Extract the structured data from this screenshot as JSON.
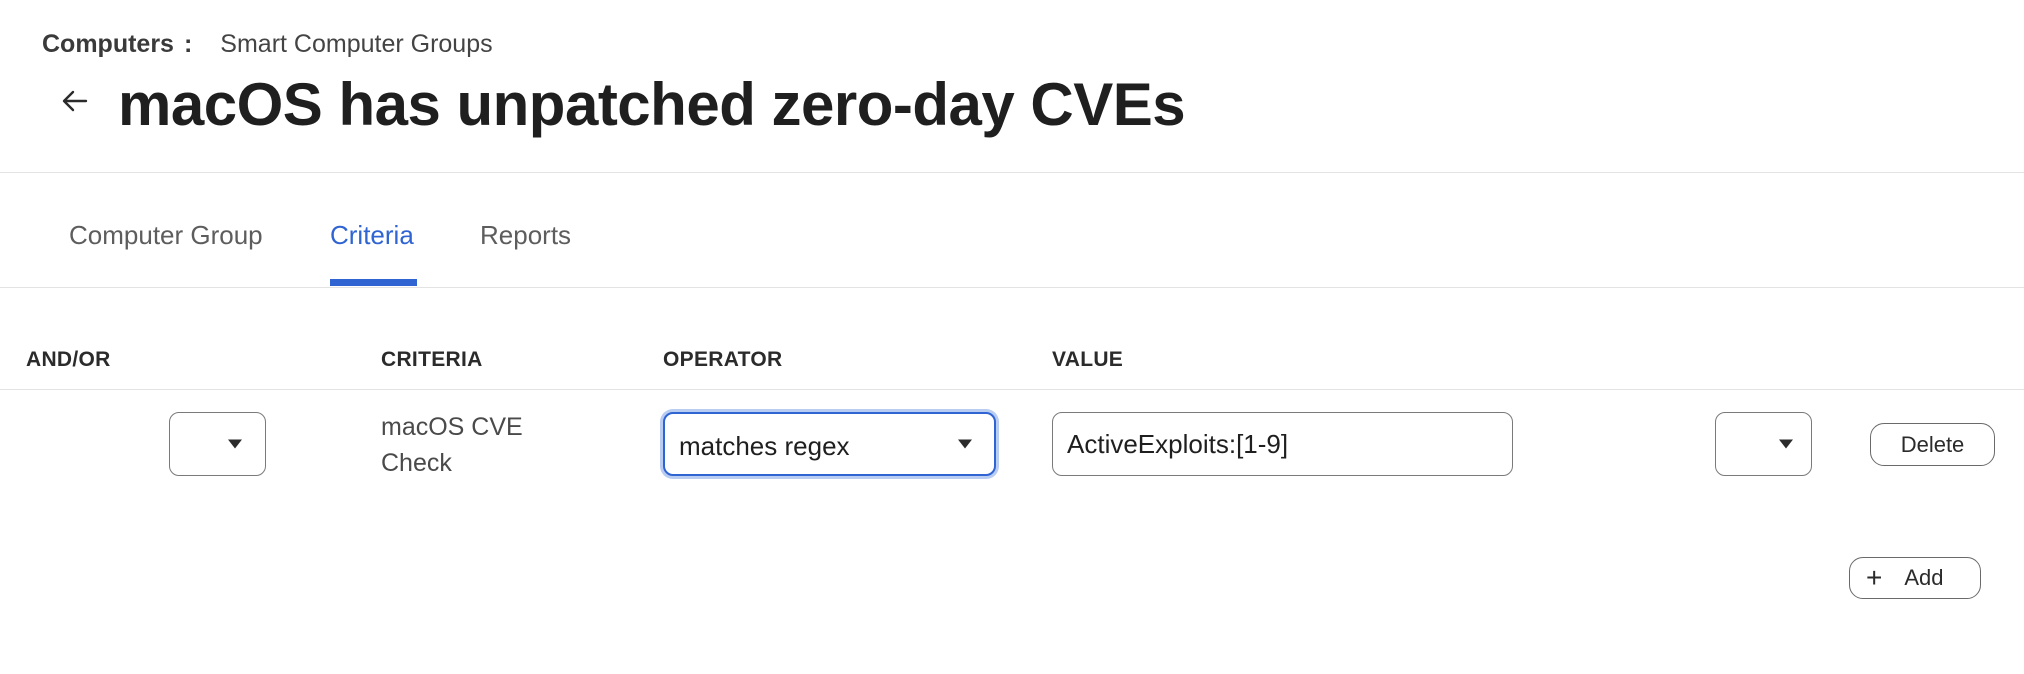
{
  "breadcrumb": {
    "section": "Computers",
    "separator": ":",
    "page": "Smart Computer Groups"
  },
  "page_title": "macOS has unpatched zero-day CVEs",
  "tabs": [
    {
      "label": "Computer Group",
      "active": false
    },
    {
      "label": "Criteria",
      "active": true
    },
    {
      "label": "Reports",
      "active": false
    }
  ],
  "table": {
    "headers": {
      "and_or": "AND/OR",
      "criteria": "CRITERIA",
      "operator": "OPERATOR",
      "value": "VALUE"
    },
    "rows": [
      {
        "and_or": "",
        "criteria": "macOS CVE Check",
        "operator": "matches regex",
        "value": "ActiveExploits:[1-9]",
        "paren": "",
        "delete_label": "Delete"
      }
    ]
  },
  "add_label": "Add",
  "icons": {
    "back": "arrow-left-icon",
    "caret": "caret-down-icon",
    "add": "plus-icon"
  },
  "colors": {
    "accent": "#2f64d2",
    "text": "#2b2b2b"
  }
}
